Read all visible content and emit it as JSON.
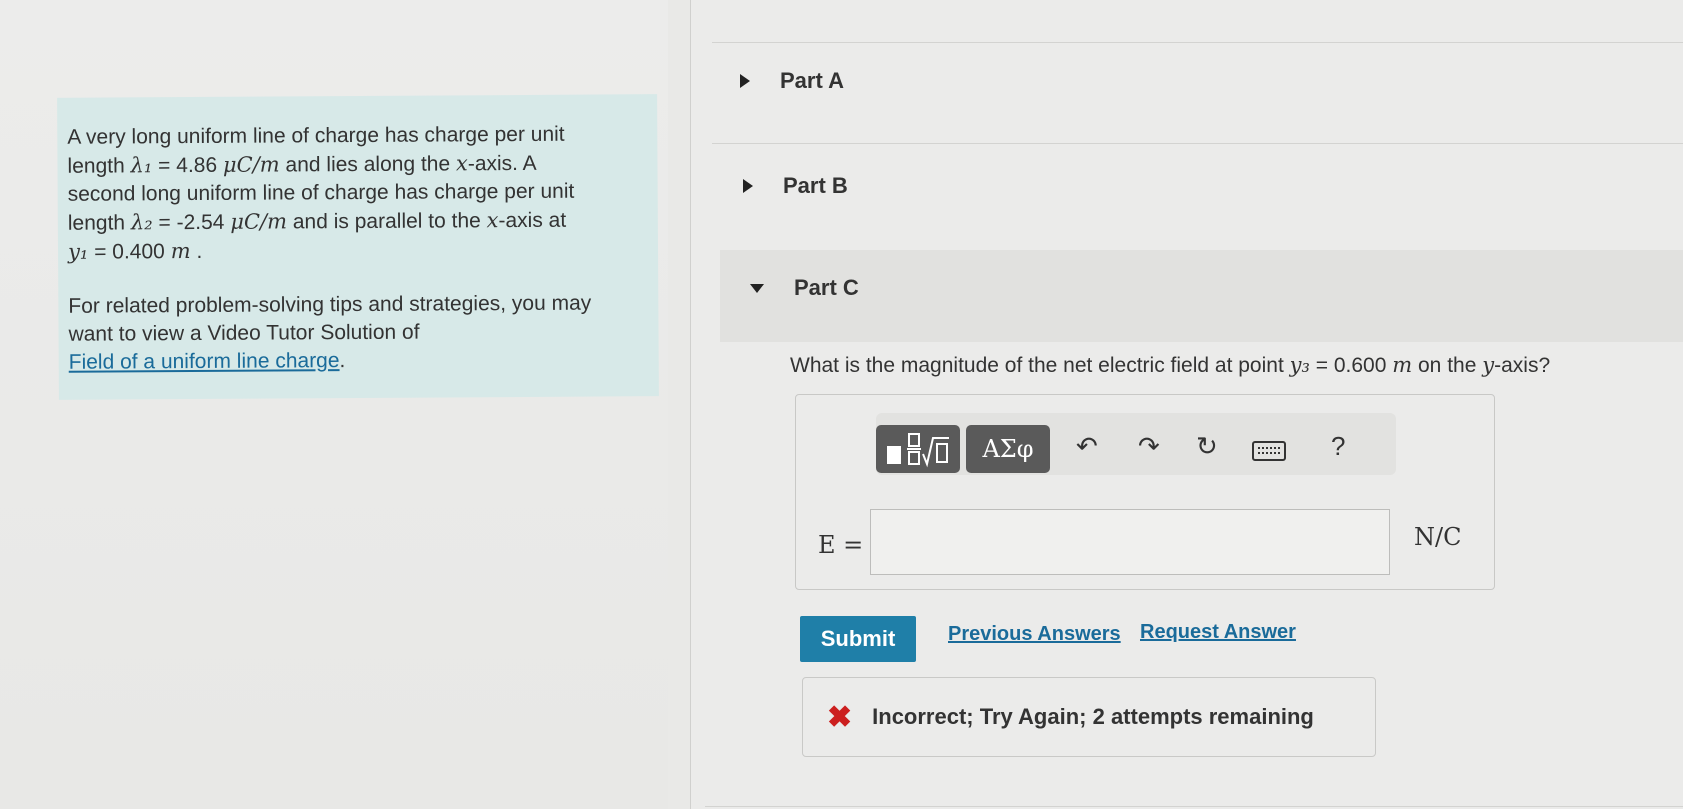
{
  "problem": {
    "line1": "A very long uniform line of charge has charge per unit",
    "line2_a": "length ",
    "line2_lambda": "λ₁",
    "line2_b": " = 4.86 ",
    "line2_unit": "μC/m",
    "line2_c": " and lies along the ",
    "line2_x": "x",
    "line2_d": "-axis. A",
    "line3": "second long uniform line of charge has charge per unit",
    "line4_a": "length ",
    "line4_lambda": "λ₂",
    "line4_b": " = -2.54 ",
    "line4_unit": "μC/m",
    "line4_c": " and is parallel to the ",
    "line4_x": "x",
    "line4_d": "-axis at",
    "line5_y": "y₁",
    "line5_b": " = 0.400 ",
    "line5_unit": "m",
    "line5_c": " ."
  },
  "tips": {
    "text1": "For related problem-solving tips and strategies, you may",
    "text2": "want to view a Video Tutor Solution of",
    "link": "Field of a uniform line charge",
    "link_end": "."
  },
  "parts": {
    "a": "Part A",
    "b": "Part B",
    "c": "Part C"
  },
  "question": {
    "a": "What is the magnitude of the net electric field at point ",
    "y": "y₃",
    "b": " = 0.600 ",
    "unit": "m",
    "c": " on the ",
    "y2": "y",
    "d": "-axis?"
  },
  "toolbar": {
    "templates_icon": "fraction-root-icon",
    "symbols_label": "ΑΣφ",
    "undo_icon": "undo-icon",
    "redo_icon": "redo-icon",
    "reset_icon": "reset-icon",
    "keyboard_icon": "keyboard-icon",
    "help_label": "?"
  },
  "answer": {
    "label": "E =",
    "value": "",
    "unit": "N/C"
  },
  "actions": {
    "submit": "Submit",
    "previous": "Previous Answers",
    "request": "Request Answer"
  },
  "feedback": {
    "text": "Incorrect; Try Again; 2 attempts remaining"
  },
  "colors": {
    "accent": "#1f7fa8",
    "error": "#cc1f1f",
    "problem_bg": "#d7e9e8"
  }
}
